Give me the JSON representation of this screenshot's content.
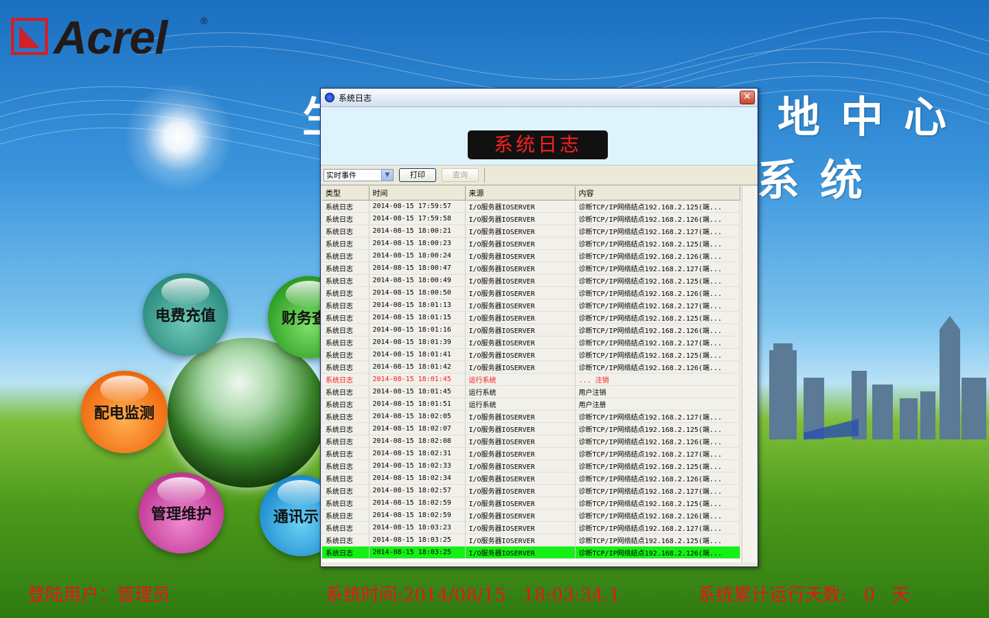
{
  "brand": {
    "logo_text": "Acrel",
    "reg_mark": "®"
  },
  "background_title": {
    "fragment_left": "生",
    "line1": "地中心",
    "line2": "系统"
  },
  "menu": {
    "fee_recharge": "电费充值",
    "finance": "财务查",
    "power_monitor": "配电监测",
    "maintenance": "管理维护",
    "comm": "通讯示"
  },
  "status_bar": {
    "user": "登陆用户：管理员",
    "time": "系统时间:2014/08/15   18:03:34.1",
    "days": "系统累计运行天数:   0   天"
  },
  "dialog": {
    "title": "系统日志",
    "banner": "系统日志",
    "close": "✕",
    "event_select": "实时事件",
    "print_btn": "打印",
    "query_btn": "查询",
    "columns": [
      "类型",
      "时间",
      "来源",
      "内容"
    ],
    "rows": [
      [
        "系统日志",
        "2014-08-15 17:59:57",
        "I/O服务器IOSERVER",
        "诊断TCP/IP网络结点192.168.2.125(端..."
      ],
      [
        "系统日志",
        "2014-08-15 17:59:58",
        "I/O服务器IOSERVER",
        "诊断TCP/IP网络结点192.168.2.126(端..."
      ],
      [
        "系统日志",
        "2014-08-15 18:00:21",
        "I/O服务器IOSERVER",
        "诊断TCP/IP网络结点192.168.2.127(端..."
      ],
      [
        "系统日志",
        "2014-08-15 18:00:23",
        "I/O服务器IOSERVER",
        "诊断TCP/IP网络结点192.168.2.125(端..."
      ],
      [
        "系统日志",
        "2014-08-15 18:00:24",
        "I/O服务器IOSERVER",
        "诊断TCP/IP网络结点192.168.2.126(端..."
      ],
      [
        "系统日志",
        "2014-08-15 18:00:47",
        "I/O服务器IOSERVER",
        "诊断TCP/IP网络结点192.168.2.127(端..."
      ],
      [
        "系统日志",
        "2014-08-15 18:00:49",
        "I/O服务器IOSERVER",
        "诊断TCP/IP网络结点192.168.2.125(端..."
      ],
      [
        "系统日志",
        "2014-08-15 18:00:50",
        "I/O服务器IOSERVER",
        "诊断TCP/IP网络结点192.168.2.126(端..."
      ],
      [
        "系统日志",
        "2014-08-15 18:01:13",
        "I/O服务器IOSERVER",
        "诊断TCP/IP网络结点192.168.2.127(端..."
      ],
      [
        "系统日志",
        "2014-08-15 18:01:15",
        "I/O服务器IOSERVER",
        "诊断TCP/IP网络结点192.168.2.125(端..."
      ],
      [
        "系统日志",
        "2014-08-15 18:01:16",
        "I/O服务器IOSERVER",
        "诊断TCP/IP网络结点192.168.2.126(端..."
      ],
      [
        "系统日志",
        "2014-08-15 18:01:39",
        "I/O服务器IOSERVER",
        "诊断TCP/IP网络结点192.168.2.127(端..."
      ],
      [
        "系统日志",
        "2014-08-15 18:01:41",
        "I/O服务器IOSERVER",
        "诊断TCP/IP网络结点192.168.2.125(端..."
      ],
      [
        "系统日志",
        "2014-08-15 18:01:42",
        "I/O服务器IOSERVER",
        "诊断TCP/IP网络结点192.168.2.126(端..."
      ],
      [
        "系统日志",
        "2014-08-15 18:01:45",
        "运行系统",
        " ... 注销"
      ],
      [
        "系统日志",
        "2014-08-15 18:01:45",
        "运行系统",
        "用户注销"
      ],
      [
        "系统日志",
        "2014-08-15 18:01:51",
        "运行系统",
        "用户注册"
      ],
      [
        "系统日志",
        "2014-08-15 18:02:05",
        "I/O服务器IOSERVER",
        "诊断TCP/IP网络结点192.168.2.127(端..."
      ],
      [
        "系统日志",
        "2014-08-15 18:02:07",
        "I/O服务器IOSERVER",
        "诊断TCP/IP网络结点192.168.2.125(端..."
      ],
      [
        "系统日志",
        "2014-08-15 18:02:08",
        "I/O服务器IOSERVER",
        "诊断TCP/IP网络结点192.168.2.126(端..."
      ],
      [
        "系统日志",
        "2014-08-15 18:02:31",
        "I/O服务器IOSERVER",
        "诊断TCP/IP网络结点192.168.2.127(端..."
      ],
      [
        "系统日志",
        "2014-08-15 18:02:33",
        "I/O服务器IOSERVER",
        "诊断TCP/IP网络结点192.168.2.125(端..."
      ],
      [
        "系统日志",
        "2014-08-15 18:02:34",
        "I/O服务器IOSERVER",
        "诊断TCP/IP网络结点192.168.2.126(端..."
      ],
      [
        "系统日志",
        "2014-08-15 18:02:57",
        "I/O服务器IOSERVER",
        "诊断TCP/IP网络结点192.168.2.127(端..."
      ],
      [
        "系统日志",
        "2014-08-15 18:02:59",
        "I/O服务器IOSERVER",
        "诊断TCP/IP网络结点192.168.2.125(端..."
      ],
      [
        "系统日志",
        "2014-08-15 18:02:59",
        "I/O服务器IOSERVER",
        "诊断TCP/IP网络结点192.168.2.126(端..."
      ],
      [
        "系统日志",
        "2014-08-15 18:03:23",
        "I/O服务器IOSERVER",
        "诊断TCP/IP网络结点192.168.2.127(端..."
      ],
      [
        "系统日志",
        "2014-08-15 18:03:25",
        "I/O服务器IOSERVER",
        "诊断TCP/IP网络结点192.168.2.125(端..."
      ],
      [
        "系统日志",
        "2014-08-15 18:03:25",
        "I/O服务器IOSERVER",
        "诊断TCP/IP网络结点192.168.2.126(端..."
      ]
    ],
    "alert_row_index": 14,
    "selected_row_index": 28
  },
  "colors": {
    "status_red": "#e8141e",
    "selected_row": "#14f014",
    "alert_text": "#ff1a1a",
    "led_text": "#ff1f1f"
  }
}
